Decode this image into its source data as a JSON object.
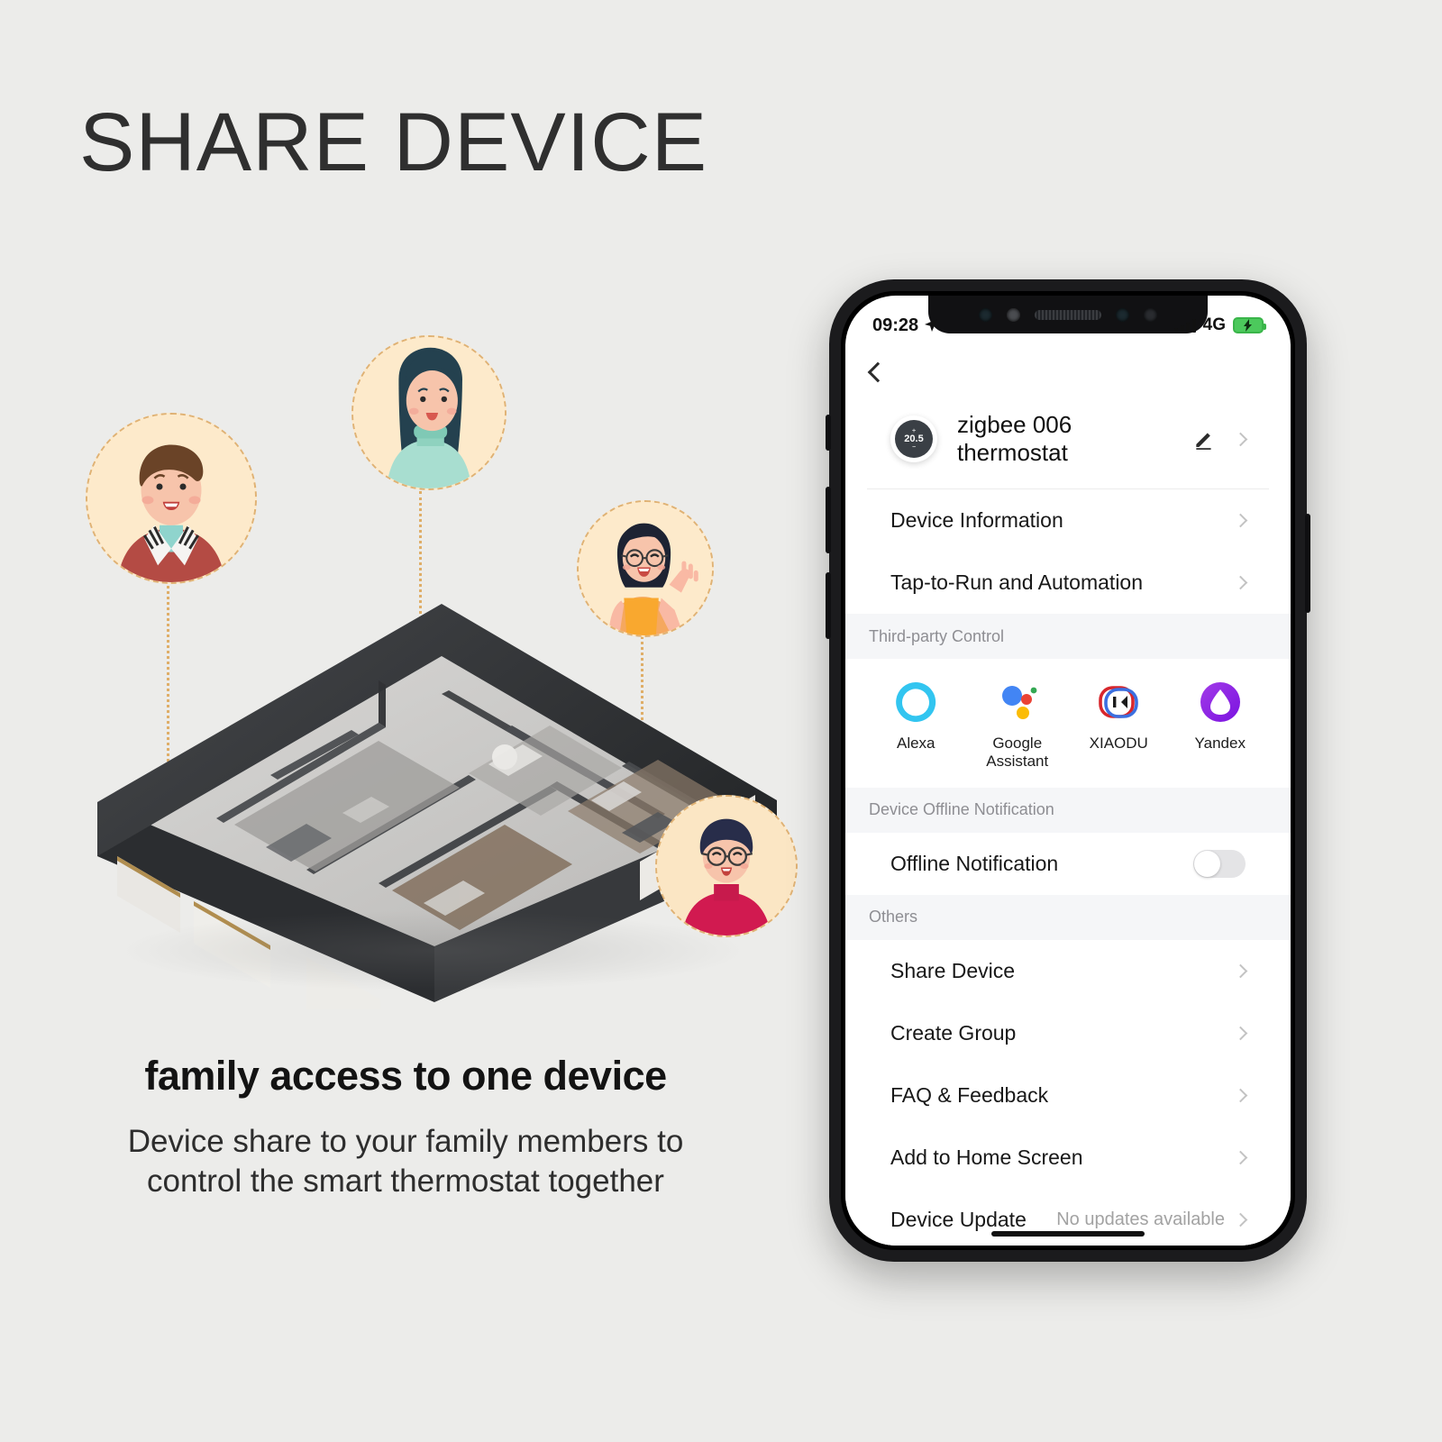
{
  "page": {
    "headline": "SHARE DEVICE",
    "caption_title": "family access to one device",
    "caption_line1": "Device share to your family members to",
    "caption_line2": "control the smart thermostat together",
    "background_color": "#ececea",
    "accent_dash_color": "#dfae68"
  },
  "illustration": {
    "house_name": "isometric-apartment-cutaway",
    "avatars": [
      {
        "name": "avatar-man-red-sweater",
        "alt": "smiling man with brown hair in red jacket"
      },
      {
        "name": "avatar-woman-long-hair",
        "alt": "woman with long dark hair in mint turtleneck"
      },
      {
        "name": "avatar-woman-glasses-waving",
        "alt": "woman with glasses in orange top waving"
      },
      {
        "name": "avatar-man-glasses-pink",
        "alt": "man with glasses in pink turtleneck"
      }
    ]
  },
  "phone": {
    "status_bar": {
      "time": "09:28",
      "location_icon": "location-arrow-icon",
      "network": "4G",
      "signal_icon": "signal-bars-icon",
      "battery_icon": "battery-charging-icon"
    },
    "nav": {
      "back_icon": "chevron-left-icon"
    },
    "device": {
      "thumbnail_temp": "20.5",
      "thumbnail_name": "thermostat-dial-icon",
      "name": "zigbee 006 thermostat",
      "edit_icon": "pencil-edit-icon",
      "chevron_icon": "chevron-right-icon"
    },
    "top_menu": [
      {
        "label": "Device Information",
        "icon": "chevron-right-icon"
      },
      {
        "label": "Tap-to-Run and Automation",
        "icon": "chevron-right-icon"
      }
    ],
    "third_party": {
      "section_title": "Third-party Control",
      "items": [
        {
          "label": "Alexa",
          "icon": "alexa-icon",
          "color": "#3bbbe8"
        },
        {
          "label": "Google\nAssistant",
          "label_l1": "Google",
          "label_l2": "Assistant",
          "icon": "google-assistant-icon",
          "color": "#4285f4"
        },
        {
          "label": "XIAODU",
          "icon": "xiaodu-icon",
          "color": "#d7262c"
        },
        {
          "label": "Yandex",
          "icon": "yandex-alice-icon",
          "color": "#8a2be2"
        }
      ]
    },
    "offline": {
      "section_title": "Device Offline Notification",
      "row_label": "Offline Notification",
      "toggle_state": "off"
    },
    "others": {
      "section_title": "Others",
      "items": [
        {
          "label": "Share Device",
          "value": "",
          "icon": "chevron-right-icon"
        },
        {
          "label": "Create Group",
          "value": "",
          "icon": "chevron-right-icon"
        },
        {
          "label": "FAQ & Feedback",
          "value": "",
          "icon": "chevron-right-icon"
        },
        {
          "label": "Add to Home Screen",
          "value": "",
          "icon": "chevron-right-icon"
        },
        {
          "label": "Device Update",
          "value": "No updates available",
          "icon": "chevron-right-icon"
        }
      ]
    },
    "home_indicator": "home-bar"
  }
}
